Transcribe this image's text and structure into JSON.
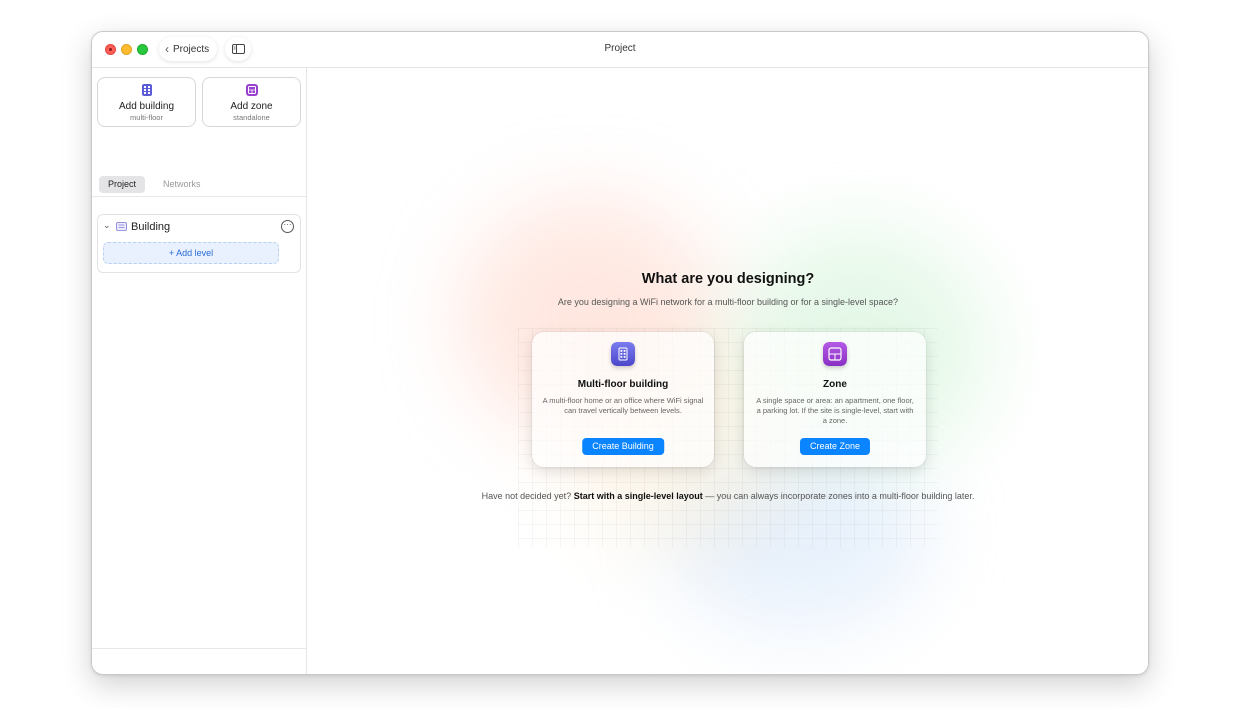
{
  "window": {
    "title": "Project",
    "back_label": "Projects"
  },
  "sidebar": {
    "add_building": {
      "title": "Add building",
      "subtitle": "multi-floor"
    },
    "add_zone": {
      "title": "Add zone",
      "subtitle": "standalone"
    },
    "tabs": [
      {
        "label": "Project",
        "active": true
      },
      {
        "label": "Networks",
        "active": false
      }
    ],
    "tree": {
      "building_label": "Building",
      "add_level_label": "+ Add level"
    }
  },
  "main": {
    "heading": "What are you designing?",
    "subheading": "Are you designing a WiFi network for a multi-floor building or for a single-level space?",
    "cards": {
      "building": {
        "title": "Multi-floor building",
        "description": "A multi-floor home or an office where WiFi signal can travel vertically between levels.",
        "button": "Create Building",
        "icon": "building-icon"
      },
      "zone": {
        "title": "Zone",
        "description": "A single space or area: an apartment, one floor, a parking lot. If the site is single-level, start with a zone.",
        "button": "Create Zone",
        "icon": "zone-icon"
      }
    },
    "footnote": {
      "prefix": "Have not decided yet?",
      "link": "Start with a single-level layout",
      "suffix": "— you can always incorporate zones into a multi-floor building later."
    }
  },
  "colors": {
    "accent": "#0a84ff",
    "building_icon": "#5b5bd6",
    "zone_icon": "#9b3fd0"
  }
}
